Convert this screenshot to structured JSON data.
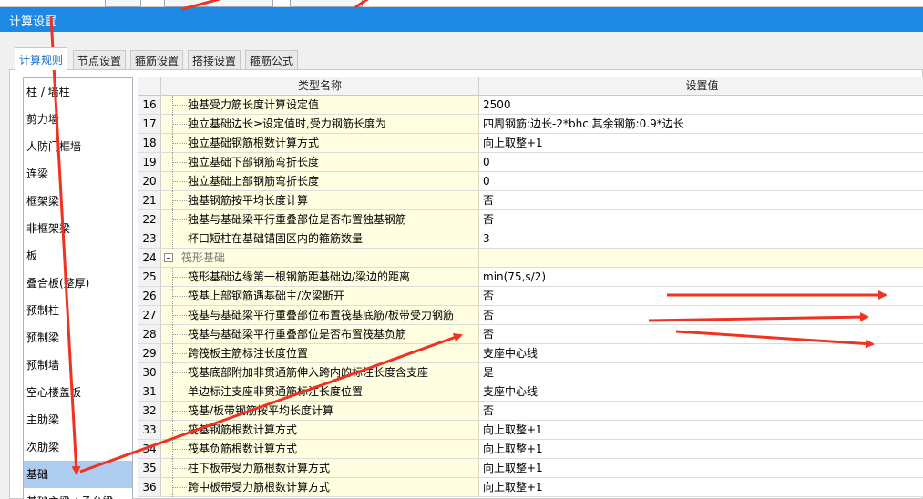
{
  "window": {
    "title": "计算设置"
  },
  "tabs": [
    {
      "label": "计算规则",
      "active": true
    },
    {
      "label": "节点设置",
      "active": false
    },
    {
      "label": "箍筋设置",
      "active": false
    },
    {
      "label": "搭接设置",
      "active": false
    },
    {
      "label": "箍筋公式",
      "active": false
    }
  ],
  "sidebar": {
    "items": [
      {
        "label": "柱 / 墙柱"
      },
      {
        "label": "剪力墙"
      },
      {
        "label": "人防门框墙"
      },
      {
        "label": "连梁"
      },
      {
        "label": "框架梁"
      },
      {
        "label": "非框架梁"
      },
      {
        "label": "板"
      },
      {
        "label": "叠合板(整厚)"
      },
      {
        "label": "预制柱"
      },
      {
        "label": "预制梁"
      },
      {
        "label": "预制墙"
      },
      {
        "label": "空心楼盖板"
      },
      {
        "label": "主肋梁"
      },
      {
        "label": "次肋梁"
      },
      {
        "label": "基础",
        "selected": true
      },
      {
        "label": "基础主梁 / 承台梁"
      }
    ]
  },
  "grid": {
    "headers": {
      "name": "类型名称",
      "value": "设置值"
    },
    "rows": [
      {
        "index": "16",
        "name": "独基受力筋长度计算设定值",
        "value": "2500"
      },
      {
        "index": "17",
        "name": "独立基础边长≥设定值时,受力钢筋长度为",
        "value": "四周钢筋:边长-2*bhc,其余钢筋:0.9*边长"
      },
      {
        "index": "18",
        "name": "独立基础钢筋根数计算方式",
        "value": "向上取整+1"
      },
      {
        "index": "19",
        "name": "独立基础下部钢筋弯折长度",
        "value": "0"
      },
      {
        "index": "20",
        "name": "独立基础上部钢筋弯折长度",
        "value": "0"
      },
      {
        "index": "21",
        "name": "独基钢筋按平均长度计算",
        "value": "否"
      },
      {
        "index": "22",
        "name": "独基与基础梁平行重叠部位是否布置独基钢筋",
        "value": "否"
      },
      {
        "index": "23",
        "name": "杯口短柱在基础锚固区内的箍筋数量",
        "value": "3"
      },
      {
        "index": "24",
        "name": "筏形基础",
        "value": "",
        "group": true
      },
      {
        "index": "25",
        "name": "筏形基础边缘第一根钢筋距基础边/梁边的距离",
        "value": "min(75,s/2)"
      },
      {
        "index": "26",
        "name": "筏基上部钢筋遇基础主/次梁断开",
        "value": "否"
      },
      {
        "index": "27",
        "name": "筏基与基础梁平行重叠部位布置筏基底筋/板带受力钢筋",
        "value": "否"
      },
      {
        "index": "28",
        "name": "筏基与基础梁平行重叠部位是否布置筏基负筋",
        "value": "否"
      },
      {
        "index": "29",
        "name": "跨筏板主筋标注长度位置",
        "value": "支座中心线"
      },
      {
        "index": "30",
        "name": "筏基底部附加非贯通筋伸入跨内的标注长度含支座",
        "value": "是"
      },
      {
        "index": "31",
        "name": "单边标注支座非贯通筋标注长度位置",
        "value": "支座中心线"
      },
      {
        "index": "32",
        "name": "筏基/板带钢筋按平均长度计算",
        "value": "否"
      },
      {
        "index": "33",
        "name": "筏基钢筋根数计算方式",
        "value": "向上取整+1"
      },
      {
        "index": "34",
        "name": "筏基负筋根数计算方式",
        "value": "向上取整+1"
      },
      {
        "index": "35",
        "name": "柱下板带受力筋根数计算方式",
        "value": "向上取整+1"
      },
      {
        "index": "36",
        "name": "跨中板带受力筋根数计算方式",
        "value": "向上取整+1"
      }
    ]
  },
  "annotations": {
    "arrow_color": "#ee3322"
  }
}
